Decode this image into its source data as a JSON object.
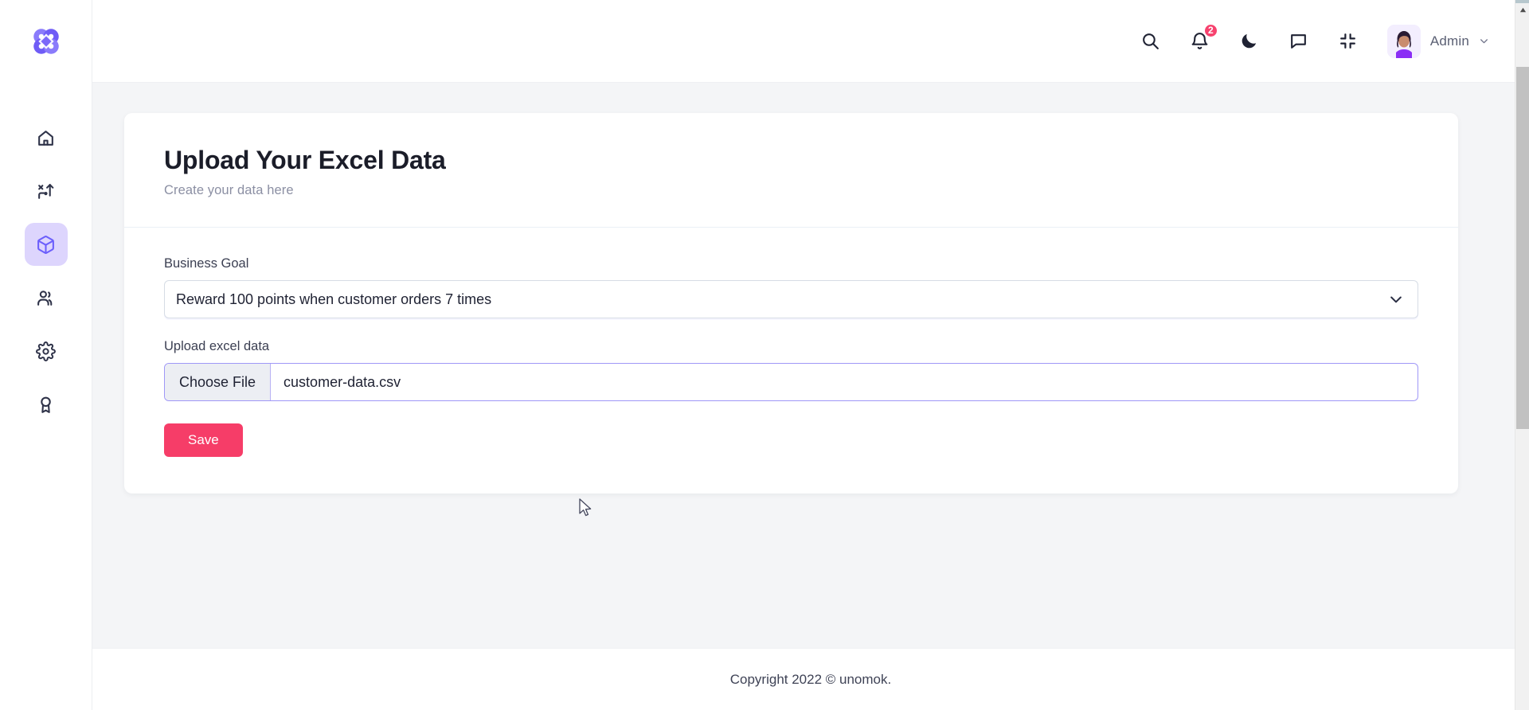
{
  "brand": {
    "logo_icon": "clover-knot-logo",
    "accent_purple": "#6C5FFC",
    "accent_purple_light": "#DDD5FD",
    "accent_pink": "#F63D68"
  },
  "sidebar": {
    "items": [
      {
        "icon": "home-icon",
        "name": "home",
        "active": false
      },
      {
        "icon": "route-shuffle-icon",
        "name": "journeys",
        "active": false
      },
      {
        "icon": "box-package-icon",
        "name": "products",
        "active": true
      },
      {
        "icon": "users-group-icon",
        "name": "customers",
        "active": false
      },
      {
        "icon": "gear-icon",
        "name": "settings",
        "active": false
      },
      {
        "icon": "award-medal-icon",
        "name": "rewards",
        "active": false
      }
    ]
  },
  "topbar": {
    "search_icon": "search-icon",
    "notifications_icon": "bell-icon",
    "notifications_count": "2",
    "theme_icon": "moon-icon",
    "messages_icon": "chat-bubble-icon",
    "fullscreen_icon": "compress-icon",
    "avatar_icon": "user-avatar",
    "profile_name": "Admin",
    "profile_chevron": "chevron-down-icon"
  },
  "main": {
    "title": "Upload Your Excel Data",
    "subtitle": "Create your data here",
    "business_goal": {
      "label": "Business Goal",
      "selected": "Reward 100 points when customer orders 7 times",
      "chevron_icon": "chevron-down-icon"
    },
    "upload": {
      "label": "Upload excel data",
      "button_label": "Choose File",
      "file_name": "customer-data.csv"
    },
    "save_label": "Save"
  },
  "footer": {
    "copyright": "Copyright 2022 © unomok."
  },
  "scrollbar": {
    "up_arrow_icon": "triangle-up-icon"
  }
}
